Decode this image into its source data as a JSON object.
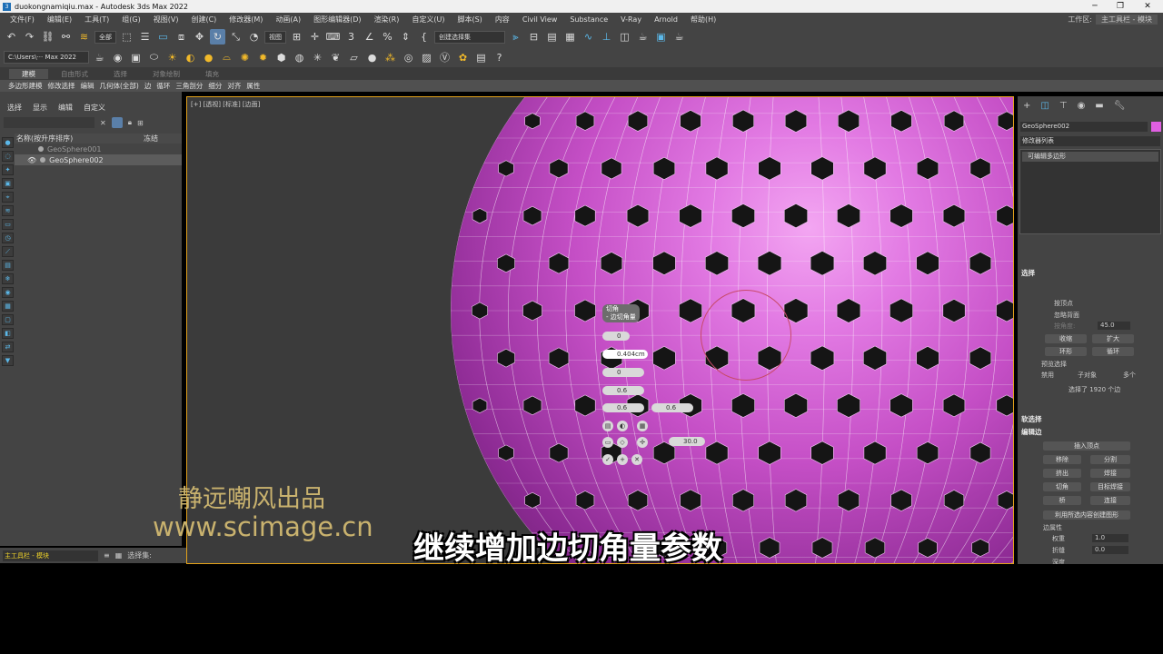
{
  "titlebar": {
    "title": "duokongnamiqiu.max - Autodesk 3ds Max 2022",
    "icon": "3ds-max-logo-icon"
  },
  "menu": {
    "items": [
      "文件(F)",
      "编辑(E)",
      "工具(T)",
      "组(G)",
      "视图(V)",
      "创建(C)",
      "修改器(M)",
      "动画(A)",
      "图形编辑器(D)",
      "渲染(R)",
      "自定义(U)",
      "脚本(S)",
      "内容",
      "Civil View",
      "Substance",
      "V-Ray",
      "Arnold",
      "帮助(H)"
    ],
    "workspace_label": "工作区:",
    "workspace_value": "主工具栏 - 模块"
  },
  "toolbar": {
    "filter": "全部",
    "view": "视图",
    "selection_set": "创建选择集",
    "path": "C:\\Users\\··· Max 2022"
  },
  "ribbon": {
    "tabs": [
      "建模",
      "自由形式",
      "选择",
      "对象绘制",
      "填充"
    ],
    "subitems": [
      "多边形建模",
      "修改选择",
      "编辑",
      "几何体(全部)",
      "边",
      "循环",
      "三角剖分",
      "细分",
      "对齐",
      "属性"
    ]
  },
  "scene": {
    "menu": [
      "选择",
      "显示",
      "编辑",
      "自定义"
    ],
    "col_name": "名称(按升序排序)",
    "col_freeze": "冻结",
    "objects": [
      "GeoSphere001",
      "GeoSphere002"
    ]
  },
  "viewport": {
    "label": "[+] [透视] [标准] [边面]"
  },
  "caddy": {
    "title_1": "切角",
    "title_2": "- 边切角量",
    "amount": "0.404cm",
    "v1": "0",
    "v2": "0",
    "v3": "0.6",
    "v4": "0.6",
    "v5": "0.6",
    "v6": "30.0"
  },
  "command_panel": {
    "object_name": "GeoSphere002",
    "swatch_color": "#e05fe2",
    "modifier_list": "修改器列表",
    "stack_item": "可编辑多边形",
    "selection_header": "选择",
    "by_vertex": "按顶点",
    "ignore_back": "忽略背面",
    "by_angle": "按角度:",
    "angle_value": "45.0",
    "shrink": "收缩",
    "grow": "扩大",
    "ring": "环形",
    "loop": "循环",
    "preview_label": "预览选择",
    "disable": "禁用",
    "subobj": "子对象",
    "multi": "多个",
    "sel_count": "选择了 1920 个边",
    "soft_sel_header": "软选择",
    "edit_edges_header": "编辑边",
    "insert_vertex": "插入顶点",
    "remove": "移除",
    "split": "分割",
    "extrude": "挤出",
    "weld": "焊接",
    "chamfer": "切角",
    "target_weld": "目标焊接",
    "bridge": "桥",
    "connect": "连接",
    "create_shape": "利用所选内容创建图形",
    "edge_props": "边属性",
    "weight": "权重",
    "weight_value": "1.0",
    "crease": "折缝",
    "crease_value": "0.0",
    "depth": "深度"
  },
  "status": {
    "layer_selector": "主工具栏 - 模块",
    "selection_set_label": "选择集:"
  },
  "overlay": {
    "watermark_cn": "静远嘲风出品",
    "watermark_url": "www.scimage.cn",
    "subtitle": "继续增加边切角量参数"
  }
}
